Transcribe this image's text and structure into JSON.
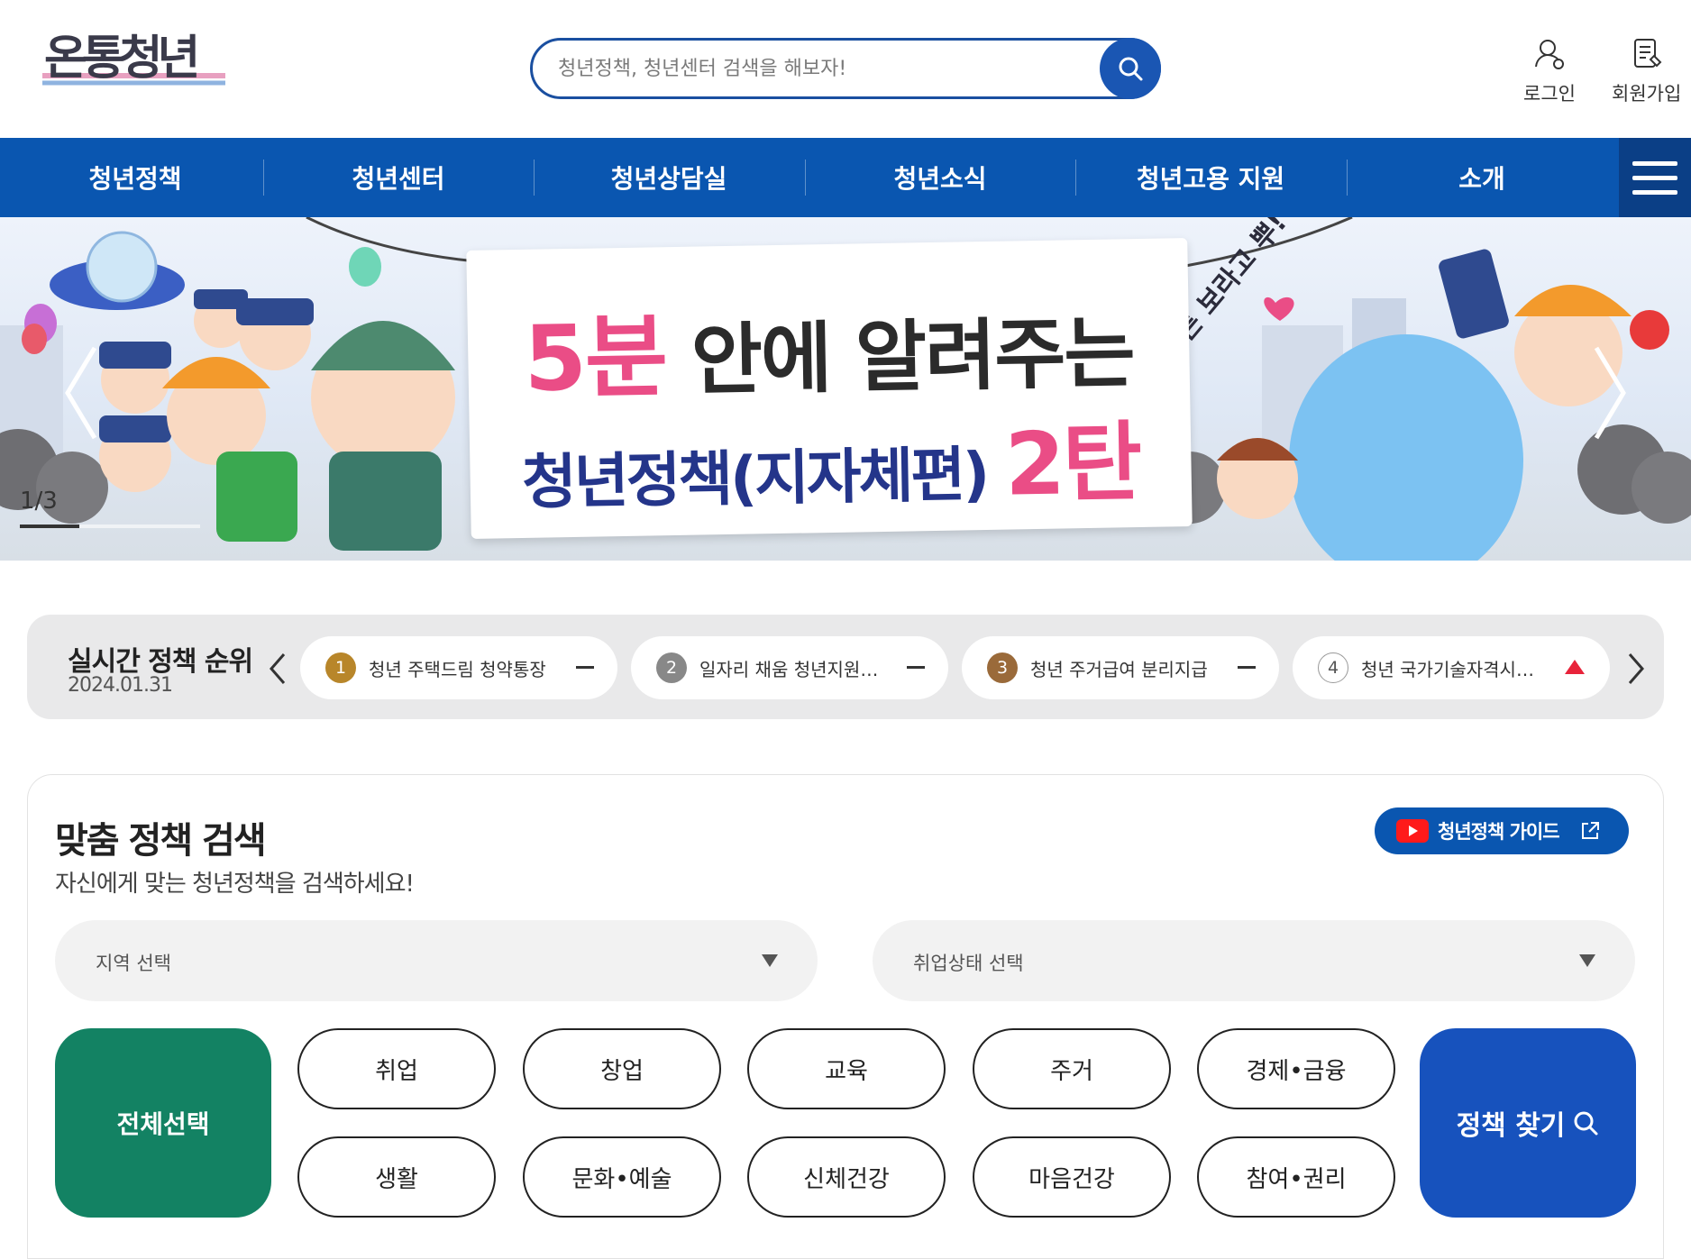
{
  "header": {
    "logo_text": "온통청년",
    "search_placeholder": "청년정책, 청년센터 검색을 해보자!",
    "login_label": "로그인",
    "join_label": "회원가입"
  },
  "gnb": {
    "items": [
      {
        "label": "청년정책"
      },
      {
        "label": "청년센터"
      },
      {
        "label": "청년상담실"
      },
      {
        "label": "청년소식"
      },
      {
        "label": "청년고용 지원"
      },
      {
        "label": "소개"
      }
    ]
  },
  "banner": {
    "line1_num": "5분",
    "line1_rest": " 안에 알려주는",
    "line2_main": "청년정책(지자체편) ",
    "line2_pink": "2탄",
    "counter": "1/3",
    "progress": 0.33
  },
  "ranking": {
    "title": "실시간 정책 순위",
    "date": "2024.01.31",
    "items": [
      {
        "rank": "1",
        "text": "청년 주택드림 청약통장",
        "trend": "same"
      },
      {
        "rank": "2",
        "text": "일자리 채움 청년지원…",
        "trend": "same"
      },
      {
        "rank": "3",
        "text": "청년 주거급여 분리지급",
        "trend": "same"
      },
      {
        "rank": "4",
        "text": "청년 국가기술자격시…",
        "trend": "up"
      }
    ]
  },
  "custom_search": {
    "title": "맞춤 정책 검색",
    "subtitle": "자신에게 맞는 청년정책을 검색하세요!",
    "guide_label": "청년정책 가이드",
    "region_select": "지역 선택",
    "employment_select": "취업상태 선택",
    "all_label": "전체선택",
    "categories_row1": [
      "취업",
      "창업",
      "교육",
      "주거",
      "경제•금융"
    ],
    "categories_row2": [
      "생활",
      "문화•예술",
      "신체건강",
      "마음건강",
      "참여•권리"
    ],
    "find_label": "정책 찾기"
  },
  "colors": {
    "primary": "#0a56b0",
    "green": "#138263",
    "find_blue": "#1752bd",
    "pink": "#ea4d86"
  }
}
